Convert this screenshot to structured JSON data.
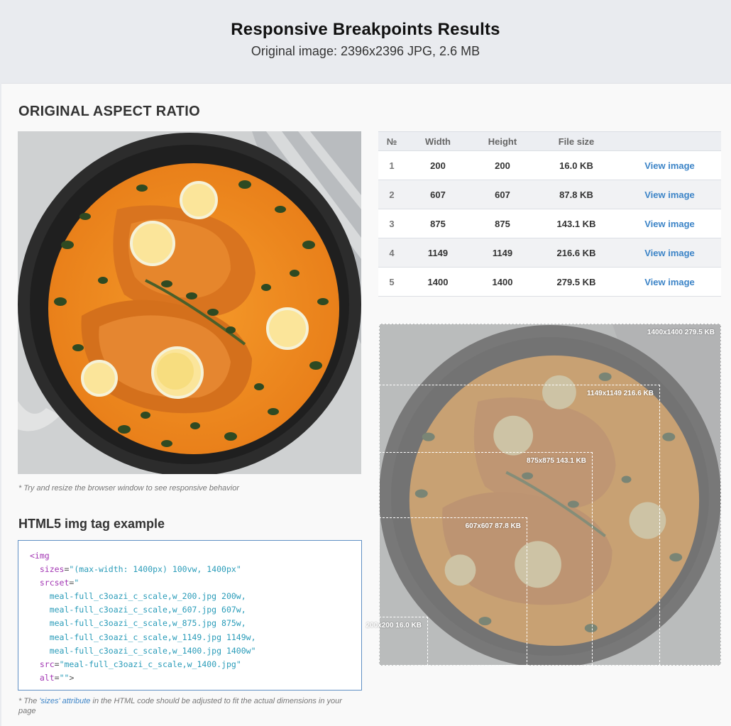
{
  "header": {
    "title": "Responsive Breakpoints Results",
    "subtitle": "Original image: 2396x2396 JPG, 2.6 MB"
  },
  "section": {
    "title": "ORIGINAL ASPECT RATIO",
    "resize_note": "* Try and resize the browser window to see responsive behavior"
  },
  "table": {
    "headers": [
      "№",
      "Width",
      "Height",
      "File size",
      ""
    ],
    "rows": [
      {
        "n": "1",
        "width": "200",
        "height": "200",
        "size": "16.0 KB",
        "link": "View image"
      },
      {
        "n": "2",
        "width": "607",
        "height": "607",
        "size": "87.8 KB",
        "link": "View image"
      },
      {
        "n": "3",
        "width": "875",
        "height": "875",
        "size": "143.1 KB",
        "link": "View image"
      },
      {
        "n": "4",
        "width": "1149",
        "height": "1149",
        "size": "216.6 KB",
        "link": "View image"
      },
      {
        "n": "5",
        "width": "1400",
        "height": "1400",
        "size": "279.5 KB",
        "link": "View image"
      }
    ]
  },
  "breakpoints": [
    {
      "label": "1400x1400 279.5 KB",
      "fraction": 1.0
    },
    {
      "label": "1149x1149 216.6 KB",
      "fraction": 0.8207
    },
    {
      "label": "875x875 143.1 KB",
      "fraction": 0.625
    },
    {
      "label": "607x607 87.8 KB",
      "fraction": 0.4336
    },
    {
      "label": "200x200 16.0 KB",
      "fraction": 0.1429
    }
  ],
  "html5": {
    "title": "HTML5 img tag example",
    "code": {
      "open": "<img",
      "sizes_attr": "sizes",
      "sizes_val": "\"(max-width: 1400px) 100vw, 1400px\"",
      "srcset_attr": "srcset",
      "srcset_open": "\"",
      "srcset_lines": [
        "meal-full_c3oazi_c_scale,w_200.jpg 200w,",
        "meal-full_c3oazi_c_scale,w_607.jpg 607w,",
        "meal-full_c3oazi_c_scale,w_875.jpg 875w,",
        "meal-full_c3oazi_c_scale,w_1149.jpg 1149w,",
        "meal-full_c3oazi_c_scale,w_1400.jpg 1400w\""
      ],
      "src_attr": "src",
      "src_val": "\"meal-full_c3oazi_c_scale,w_1400.jpg\"",
      "alt_attr": "alt",
      "alt_val": "\"\"",
      "close": ">"
    },
    "note_prefix": "* The ",
    "note_link": "'sizes' attribute",
    "note_suffix": " in the HTML code should be adjusted to fit the actual dimensions in your page"
  },
  "colors": {
    "accent": "#3c84c7",
    "code_border": "#5f8fc4",
    "sauce": "#f0901e"
  }
}
